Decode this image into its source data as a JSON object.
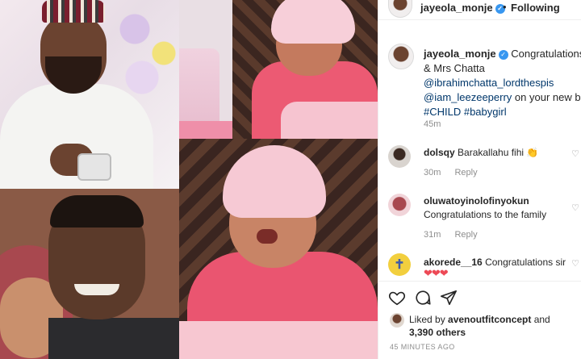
{
  "header": {
    "username": "jayeola_monje",
    "separator": "•",
    "follow_status": "Following"
  },
  "caption": {
    "username": "jayeola_monje",
    "line1_rest": "Congratulations Mr",
    "line2": "& Mrs Chatta",
    "line3": "@ibrahimchatta_lordthespis",
    "line4_mention": "@iam_leezeeperry",
    "line4_rest": " on your new born",
    "line5": "#CHILD #babygirl",
    "time": "45m"
  },
  "comments": [
    {
      "username": "dolsqy",
      "text": "Barakallahu fihi",
      "emoji": "👏",
      "time": "30m",
      "reply_label": "Reply"
    },
    {
      "username": "oluwatoyinolofinyokun",
      "text": "Congratulations to the family",
      "time": "31m",
      "reply_label": "Reply"
    },
    {
      "username": "akorede__16",
      "text": "Congratulations sir",
      "emoji": "❤❤❤"
    }
  ],
  "actions": {
    "like_icon": "heart-icon",
    "comment_icon": "comment-icon",
    "share_icon": "share-icon"
  },
  "likes": {
    "prefix": "Liked by ",
    "user": "avenoutfitconcept",
    "middle": " and",
    "count": "3,390 others"
  },
  "post_time": "45 MINUTES AGO",
  "colors": {
    "link": "#00376b",
    "verified": "#3897f0",
    "muted": "#8e8e8e",
    "heart_red": "#ed4956"
  }
}
